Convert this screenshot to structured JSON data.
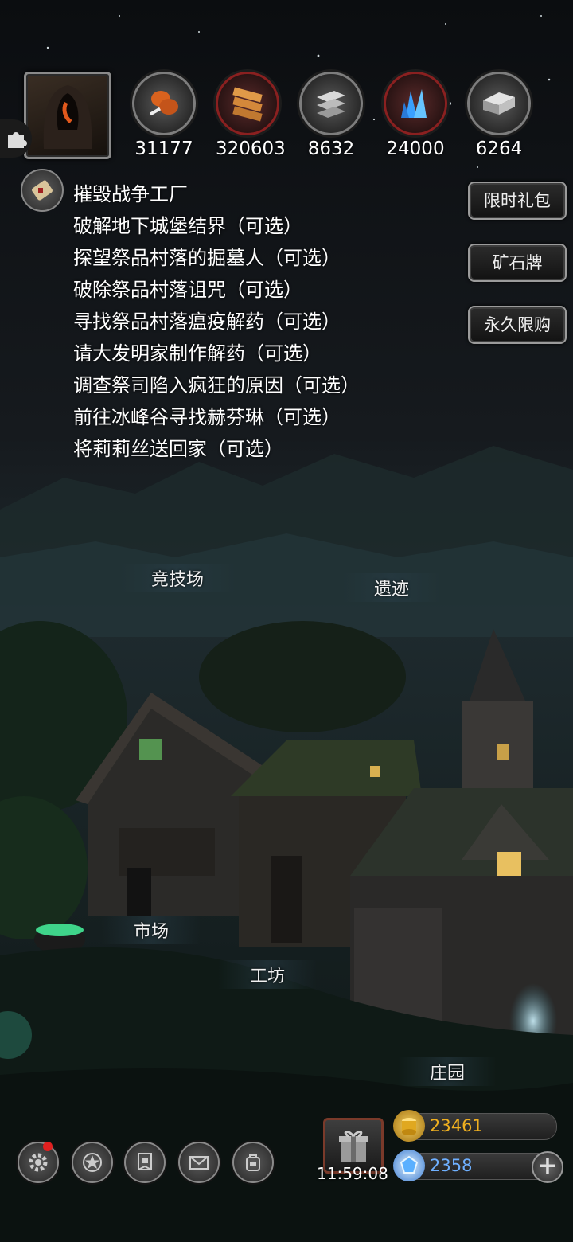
{
  "resources": [
    {
      "icon": "meat-icon",
      "value": "31177",
      "ring": "grey"
    },
    {
      "icon": "wood-planks-icon",
      "value": "320603",
      "ring": "red"
    },
    {
      "icon": "stone-bricks-icon",
      "value": "8632",
      "ring": "grey"
    },
    {
      "icon": "blue-crystal-icon",
      "value": "24000",
      "ring": "red"
    },
    {
      "icon": "iron-ingot-icon",
      "value": "6264",
      "ring": "grey"
    }
  ],
  "quests": [
    "摧毁战争工厂",
    "破解地下城堡结界（可选）",
    "探望祭品村落的掘墓人（可选）",
    "破除祭品村落诅咒（可选）",
    "寻找祭品村落瘟疫解药（可选）",
    "请大发明家制作解药（可选）",
    "调查祭司陷入疯狂的原因（可选）",
    "前往冰峰谷寻找赫芬琳（可选）",
    "将莉莉丝送回家（可选）"
  ],
  "side_buttons": {
    "limited_pack": "限时礼包",
    "ore_card": "矿石牌",
    "permanent_limit": "永久限购"
  },
  "locations": {
    "arena": "竞技场",
    "ruins": "遗迹",
    "market": "市场",
    "workshop": "工坊",
    "manor": "庄园"
  },
  "gift_timer": "11:59:08",
  "currency": {
    "gold": "23461",
    "gems": "2358"
  },
  "colors": {
    "gold_text": "#f0b020",
    "gem_text": "#6fb0ff",
    "notification": "#e02020"
  }
}
